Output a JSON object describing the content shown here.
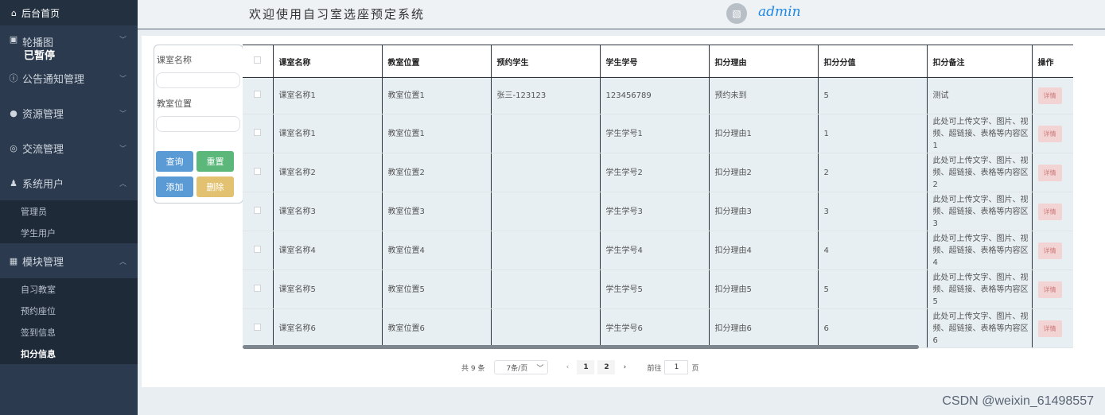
{
  "sidebar": {
    "home": "后台首页",
    "groups": [
      {
        "label": "轮播图"
      },
      {
        "label": "公告通知管理"
      },
      {
        "label": "资源管理"
      },
      {
        "label": "交流管理"
      },
      {
        "label": "系统用户"
      },
      {
        "label": "模块管理"
      }
    ],
    "paused_tag": "已暂停",
    "system_users_items": [
      "管理员",
      "学生用户"
    ],
    "module_items": [
      "自习教室",
      "预约座位",
      "签到信息",
      "扣分信息"
    ],
    "active_item": "扣分信息"
  },
  "header": {
    "title": "欢迎使用自习室选座预定系统",
    "username": "admin"
  },
  "search": {
    "room_name_label": "课室名称",
    "room_location_label": "教室位置",
    "room_name_value": "",
    "room_location_value": "",
    "query_button": "查询",
    "reset_button": "重置",
    "add_button": "添加",
    "delete_button": "删除"
  },
  "table": {
    "columns": [
      "课室名称",
      "教室位置",
      "预约学生",
      "学生学号",
      "扣分理由",
      "扣分分值",
      "扣分备注",
      "操作"
    ],
    "rows": [
      {
        "name": "课室名称1",
        "location": "教室位置1",
        "student": "张三-123123",
        "student_id": "123456789",
        "reason": "预约未到",
        "score": "5",
        "remark": "测试",
        "action": "详情"
      },
      {
        "name": "课室名称1",
        "location": "教室位置1",
        "student": "",
        "student_id": "学生学号1",
        "reason": "扣分理由1",
        "score": "1",
        "remark": "此处可上传文字、图片、视频、超链接、表格等内容区1",
        "action": "详情"
      },
      {
        "name": "课室名称2",
        "location": "教室位置2",
        "student": "",
        "student_id": "学生学号2",
        "reason": "扣分理由2",
        "score": "2",
        "remark": "此处可上传文字、图片、视频、超链接、表格等内容区2",
        "action": "详情"
      },
      {
        "name": "课室名称3",
        "location": "教室位置3",
        "student": "",
        "student_id": "学生学号3",
        "reason": "扣分理由3",
        "score": "3",
        "remark": "此处可上传文字、图片、视频、超链接、表格等内容区3",
        "action": "详情"
      },
      {
        "name": "课室名称4",
        "location": "教室位置4",
        "student": "",
        "student_id": "学生学号4",
        "reason": "扣分理由4",
        "score": "4",
        "remark": "此处可上传文字、图片、视频、超链接、表格等内容区4",
        "action": "详情"
      },
      {
        "name": "课室名称5",
        "location": "教室位置5",
        "student": "",
        "student_id": "学生学号5",
        "reason": "扣分理由5",
        "score": "5",
        "remark": "此处可上传文字、图片、视频、超链接、表格等内容区5",
        "action": "详情"
      },
      {
        "name": "课室名称6",
        "location": "教室位置6",
        "student": "",
        "student_id": "学生学号6",
        "reason": "扣分理由6",
        "score": "6",
        "remark": "此处可上传文字、图片、视频、超链接、表格等内容区6",
        "action": "详情"
      }
    ]
  },
  "pagination": {
    "total": "共 9 条",
    "page_size": "7条/页",
    "pages": [
      "1",
      "2"
    ],
    "goto_label": "前往",
    "goto_value": "1",
    "page_unit": "页"
  },
  "watermark": "CSDN @weixin_61498557"
}
